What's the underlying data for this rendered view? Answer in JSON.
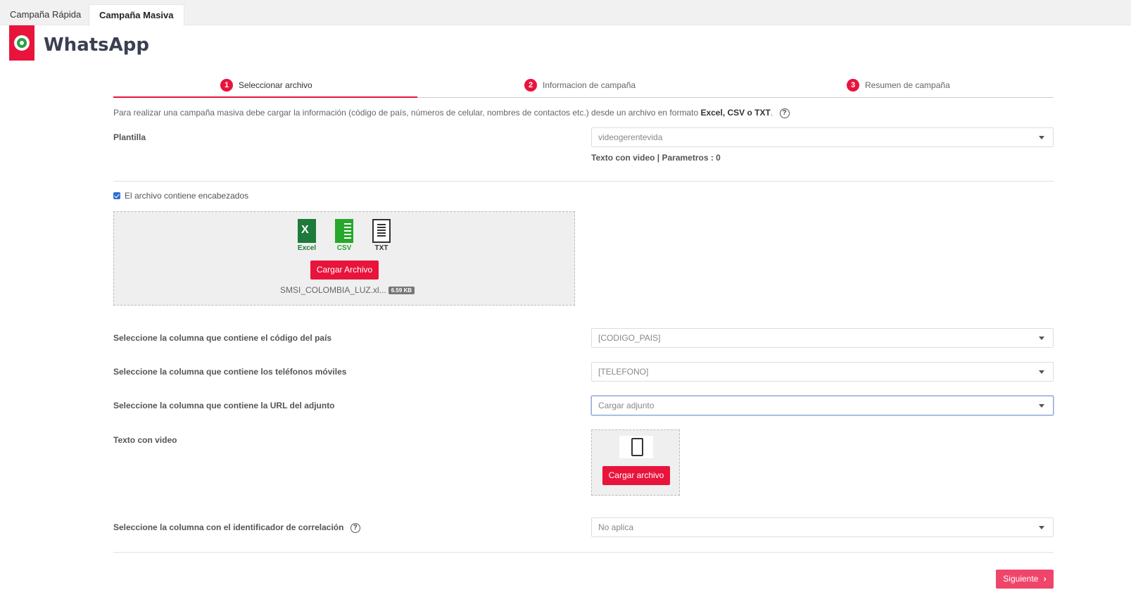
{
  "tabs": [
    {
      "label": "Campaña Rápida"
    },
    {
      "label": "Campaña Masiva"
    }
  ],
  "header": {
    "title": "WhatsApp"
  },
  "steps": [
    {
      "num": "1",
      "label": "Seleccionar archivo"
    },
    {
      "num": "2",
      "label": "Informacion de campaña"
    },
    {
      "num": "3",
      "label": "Resumen de campaña"
    }
  ],
  "intro": {
    "text": "Para realizar una campaña masiva debe cargar la información (código de país, números de celular, nombres de contactos etc.) desde un archivo en formato ",
    "formats": "Excel, CSV o TXT",
    "end": ".",
    "help": "?"
  },
  "template": {
    "label": "Plantilla",
    "value": "videogerentevida",
    "info": "Texto con video | Parametros : 0"
  },
  "headers_checkbox": {
    "label": "El archivo contiene encabezados",
    "checked": true
  },
  "upload": {
    "icons": [
      {
        "label": "Excel"
      },
      {
        "label": "CSV"
      },
      {
        "label": "TXT"
      }
    ],
    "button": "Cargar Archivo",
    "filename": "SMSI_COLOMBIA_LUZ.xl...",
    "size": "6.59 KB"
  },
  "fields": {
    "country": {
      "label": "Seleccione la columna que contiene el código del país",
      "value": "[CODIGO_PAIS]"
    },
    "phone": {
      "label": "Seleccione la columna que contiene los teléfonos móviles",
      "value": "[TELEFONO]"
    },
    "url": {
      "label": "Seleccione la columna que contiene la URL del adjunto",
      "value": "Cargar adjunto"
    },
    "video": {
      "label": "Texto con video",
      "button": "Cargar archivo"
    },
    "correlation": {
      "label": "Seleccione la columna con el identificador de correlación",
      "value": "No aplica",
      "help": "?"
    }
  },
  "footer": {
    "next": "Siguiente",
    "next_arrow": "›"
  }
}
